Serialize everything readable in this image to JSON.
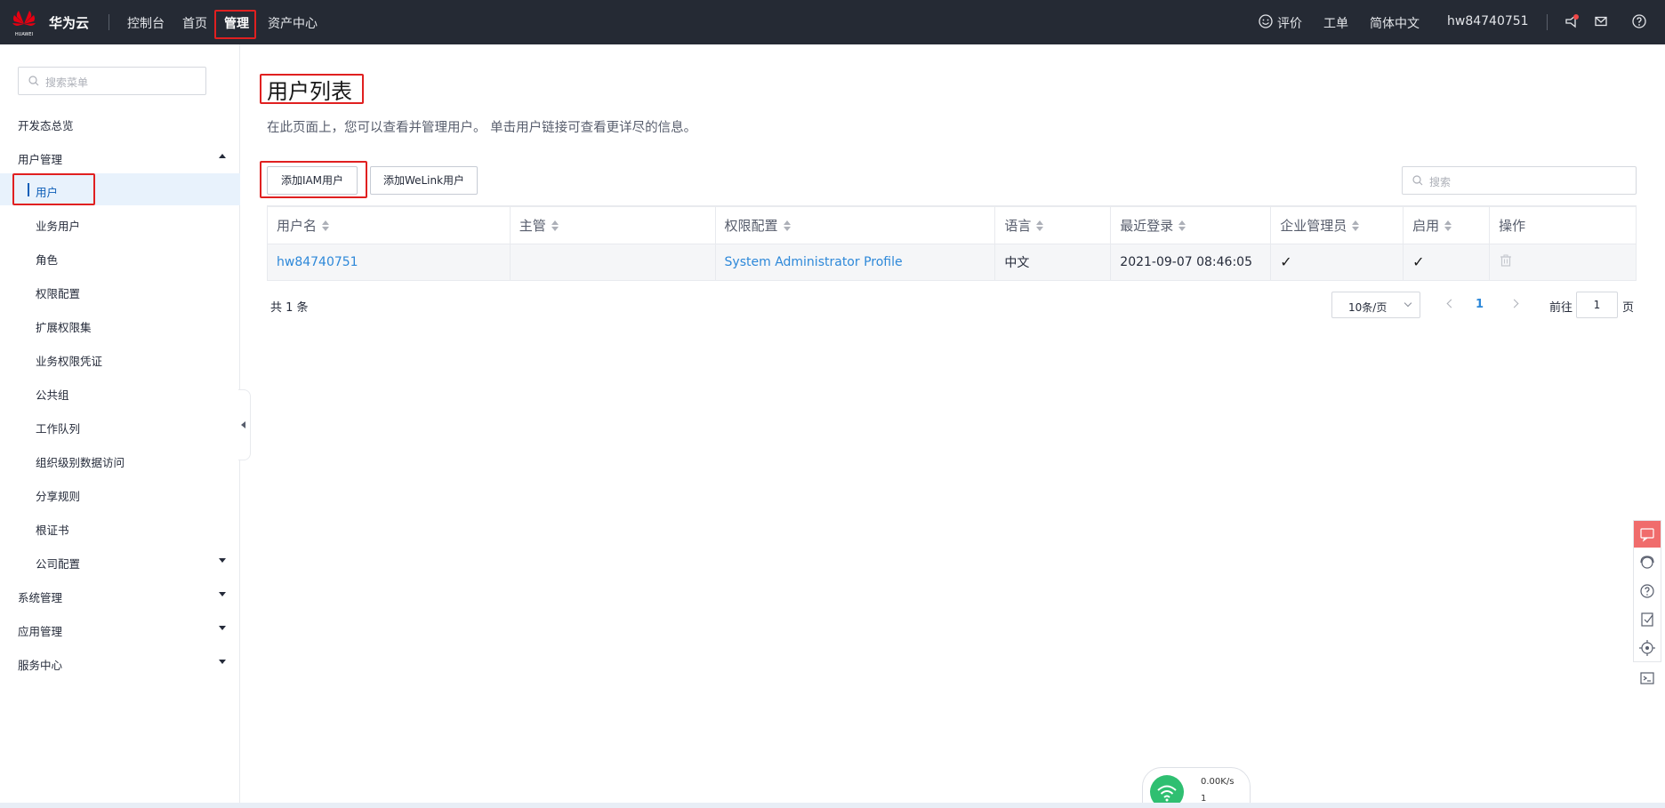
{
  "topbar": {
    "brand": "华为云",
    "logo_text": "HUAWEI",
    "nav": [
      "控制台",
      "首页",
      "管理",
      "资产中心"
    ],
    "active_nav": "管理",
    "feedback": "评价",
    "ticket": "工单",
    "language": "简体中文",
    "username": "hw84740751",
    "icons": [
      "smile-icon",
      "notification-icon",
      "mail-icon",
      "help-icon"
    ]
  },
  "sidebar": {
    "search_placeholder": "搜索菜单",
    "items": [
      {
        "label": "开发态总览"
      },
      {
        "label": "用户管理"
      },
      {
        "label": "用户"
      },
      {
        "label": "业务用户"
      },
      {
        "label": "角色"
      },
      {
        "label": "权限配置"
      },
      {
        "label": "扩展权限集"
      },
      {
        "label": "业务权限凭证"
      },
      {
        "label": "公共组"
      },
      {
        "label": "工作队列"
      },
      {
        "label": "组织级别数据访问"
      },
      {
        "label": "分享规则"
      },
      {
        "label": "根证书"
      },
      {
        "label": "公司配置"
      },
      {
        "label": "系统管理"
      },
      {
        "label": "应用管理"
      },
      {
        "label": "服务中心"
      }
    ]
  },
  "main": {
    "title": "用户列表",
    "description": "在此页面上，您可以查看并管理用户。 单击用户链接可查看更详尽的信息。",
    "add_iam_button": "添加IAM用户",
    "add_welink_button": "添加WeLink用户",
    "search_placeholder": "搜索",
    "table": {
      "columns": [
        "用户名",
        "主管",
        "权限配置",
        "语言",
        "最近登录",
        "企业管理员",
        "启用",
        "操作"
      ],
      "rows": [
        {
          "username": "hw84740751",
          "manager": "",
          "profile": "System Administrator Profile",
          "language": "中文",
          "last_login": "2021-09-07 08:46:05",
          "is_admin": "✓",
          "enabled": "✓"
        }
      ]
    },
    "total": "共 1 条",
    "page_size": "10条/页",
    "current_page": "1",
    "goto_label": "前往",
    "goto_value": "1",
    "page_suffix": "页"
  },
  "network_widget": {
    "rate": "0.00K/s",
    "count": "1"
  },
  "colors": {
    "topbar_bg": "#252a34",
    "link": "#2d88d9",
    "highlight": "#e02020",
    "selected_bg": "#e8f2fc"
  }
}
